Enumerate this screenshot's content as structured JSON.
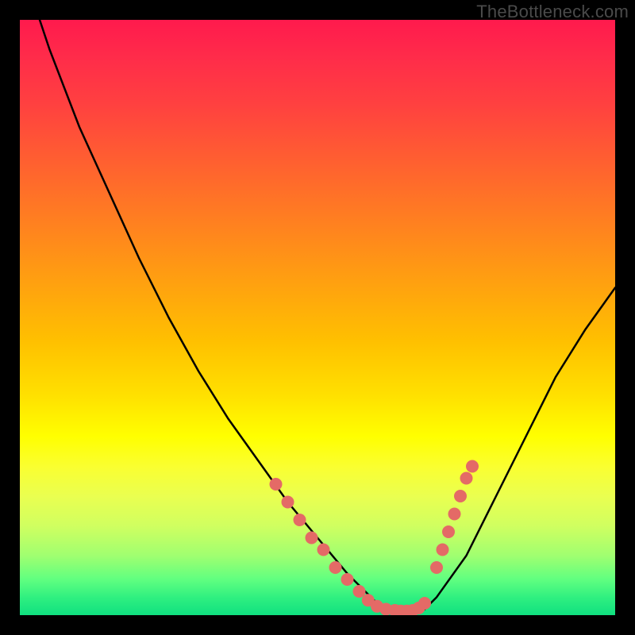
{
  "watermark": "TheBottleneck.com",
  "chart_data": {
    "type": "line",
    "title": "",
    "xlabel": "",
    "ylabel": "",
    "xlim": [
      0,
      100
    ],
    "ylim": [
      0,
      100
    ],
    "series": [
      {
        "name": "curve",
        "color": "#000000",
        "x": [
          0,
          5,
          10,
          15,
          20,
          25,
          30,
          35,
          40,
          45,
          50,
          55,
          58,
          60,
          62,
          64,
          66,
          68,
          70,
          75,
          80,
          85,
          90,
          95,
          100
        ],
        "y": [
          110,
          95,
          82,
          71,
          60,
          50,
          41,
          33,
          26,
          19,
          13,
          7,
          4,
          2,
          1,
          0.5,
          0.5,
          1,
          3,
          10,
          20,
          30,
          40,
          48,
          55
        ]
      }
    ],
    "markers": {
      "name": "highlighted-points",
      "color": "#e46a66",
      "radius_px": 8,
      "points": [
        {
          "x": 43,
          "y": 22
        },
        {
          "x": 45,
          "y": 19
        },
        {
          "x": 47,
          "y": 16
        },
        {
          "x": 49,
          "y": 13
        },
        {
          "x": 51,
          "y": 11
        },
        {
          "x": 53,
          "y": 8
        },
        {
          "x": 55,
          "y": 6
        },
        {
          "x": 57,
          "y": 4
        },
        {
          "x": 58.5,
          "y": 2.5
        },
        {
          "x": 60,
          "y": 1.5
        },
        {
          "x": 61.5,
          "y": 1
        },
        {
          "x": 63,
          "y": 0.8
        },
        {
          "x": 64,
          "y": 0.7
        },
        {
          "x": 65,
          "y": 0.7
        },
        {
          "x": 66,
          "y": 0.8
        },
        {
          "x": 67,
          "y": 1.2
        },
        {
          "x": 68,
          "y": 2
        },
        {
          "x": 70,
          "y": 8
        },
        {
          "x": 71,
          "y": 11
        },
        {
          "x": 72,
          "y": 14
        },
        {
          "x": 73,
          "y": 17
        },
        {
          "x": 74,
          "y": 20
        },
        {
          "x": 75,
          "y": 23
        },
        {
          "x": 76,
          "y": 25
        }
      ]
    }
  }
}
